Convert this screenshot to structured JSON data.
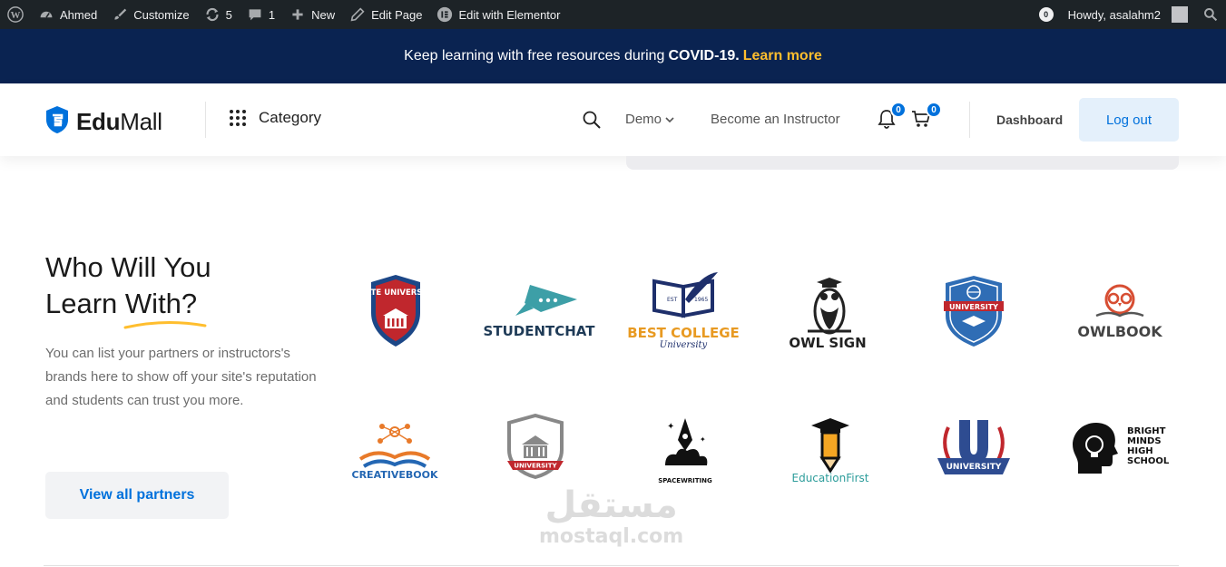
{
  "adminbar": {
    "site_name": "Ahmed",
    "customize": "Customize",
    "updates_count": "5",
    "comments_count": "1",
    "new_label": "New",
    "edit_page": "Edit Page",
    "edit_elementor": "Edit with Elementor",
    "notif_count": "0",
    "howdy": "Howdy, asalahm2"
  },
  "promo": {
    "text": "Keep learning with free resources during",
    "highlight": "COVID-19.",
    "link": "Learn more"
  },
  "header": {
    "logo_part1": "Edu",
    "logo_part2": "Mall",
    "category": "Category",
    "demo": "Demo",
    "instructor": "Become an Instructor",
    "notifications_count": "0",
    "cart_count": "0",
    "dashboard": "Dashboard",
    "logout": "Log out"
  },
  "partners": {
    "heading_line1": "Who Will You",
    "heading_line2a": "Learn",
    "heading_line2b": "With?",
    "description": "You can list your partners or instructors's brands here to show off your site's reputation and students can trust you more.",
    "button": "View all partners",
    "logos": [
      {
        "name": "STATE UNIVERSITY"
      },
      {
        "name": "STUDENTCHAT"
      },
      {
        "name": "BEST COLLEGE",
        "sub": "University"
      },
      {
        "name": "OWL SIGN"
      },
      {
        "name": "UNIVERSITY"
      },
      {
        "name": "OWLBOOK"
      },
      {
        "name": "CREATIVEBOOK"
      },
      {
        "name": "UNIVERSITY"
      },
      {
        "name": "SPACEWRITING"
      },
      {
        "name": "EducationFirst"
      },
      {
        "name": "UNIVERSITY"
      },
      {
        "name": "BRIGHT MINDS HIGH SCHOOL"
      }
    ]
  },
  "watermark": {
    "arabic": "مستقل",
    "latin": "mostaql.com"
  },
  "colors": {
    "accent": "#0071dc",
    "navy": "#0a2351",
    "yellow": "#ffbe2e"
  }
}
